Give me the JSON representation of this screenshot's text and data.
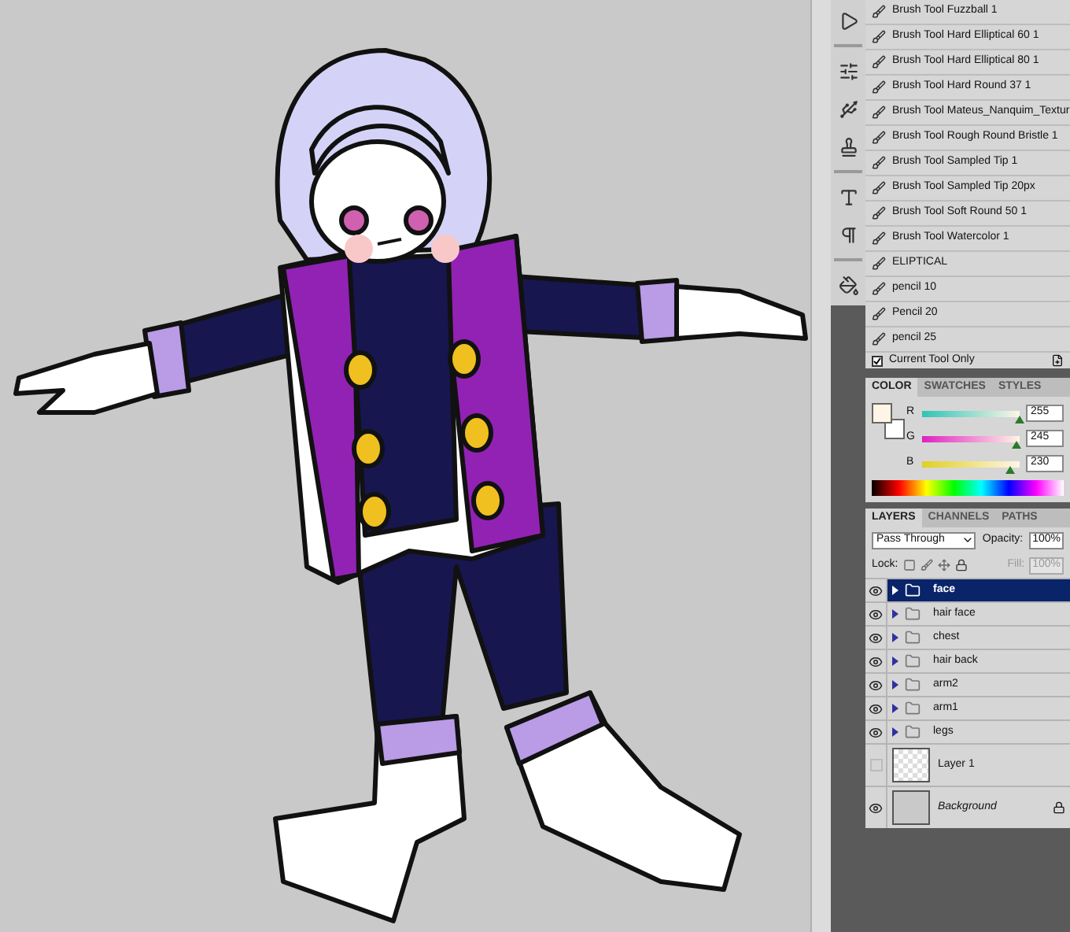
{
  "tool_presets": {
    "items": [
      {
        "label": "Brush Tool Fuzzball 1"
      },
      {
        "label": "Brush Tool Hard Elliptical 60 1"
      },
      {
        "label": "Brush Tool Hard Elliptical 80 1"
      },
      {
        "label": "Brush Tool Hard Round 37 1"
      },
      {
        "label": "Brush Tool Mateus_Nanquim_Textur"
      },
      {
        "label": "Brush Tool Rough Round Bristle 1"
      },
      {
        "label": "Brush Tool Sampled Tip 1"
      },
      {
        "label": "Brush Tool Sampled Tip 20px"
      },
      {
        "label": "Brush Tool Soft Round 50 1"
      },
      {
        "label": "Brush Tool Watercolor 1"
      },
      {
        "label": "ELIPTICAL"
      },
      {
        "label": "pencil 10"
      },
      {
        "label": "Pencil 20"
      },
      {
        "label": "pencil 25"
      }
    ],
    "current_tool_only": {
      "label": "Current Tool Only",
      "checked": true
    }
  },
  "color_panel": {
    "tabs": [
      {
        "label": "COLOR",
        "selected": true
      },
      {
        "label": "SWATCHES",
        "selected": false
      },
      {
        "label": "STYLES",
        "selected": false
      }
    ],
    "sliders": [
      {
        "channel": "R",
        "level": 1.0,
        "reading": "255"
      },
      {
        "channel": "G",
        "level": 0.96,
        "reading": "245"
      },
      {
        "channel": "B",
        "level": 0.9,
        "reading": "230"
      }
    ]
  },
  "layers_panel": {
    "tabs": [
      {
        "label": "LAYERS",
        "selected": true
      },
      {
        "label": "CHANNELS",
        "selected": false
      },
      {
        "label": "PATHS",
        "selected": false
      }
    ],
    "blend_mode": "Pass Through",
    "opacity_label": "Opacity:",
    "opacity": "100%",
    "lock_label": "Lock:",
    "fill_label": "Fill:",
    "fill": "100%",
    "fill_disabled": true,
    "layers": [
      {
        "name": "face",
        "kind": "group",
        "visible": true,
        "selected": true
      },
      {
        "name": "hair face",
        "kind": "group",
        "visible": true,
        "selected": false
      },
      {
        "name": "chest",
        "kind": "group",
        "visible": true,
        "selected": false
      },
      {
        "name": "hair back",
        "kind": "group",
        "visible": true,
        "selected": false
      },
      {
        "name": "arm2",
        "kind": "group",
        "visible": true,
        "selected": false
      },
      {
        "name": "arm1",
        "kind": "group",
        "visible": true,
        "selected": false
      },
      {
        "name": "legs",
        "kind": "group",
        "visible": true,
        "selected": false
      },
      {
        "name": "Layer 1",
        "kind": "transparent",
        "visible": false,
        "selected": false
      },
      {
        "name": "Background",
        "kind": "background",
        "visible": true,
        "selected": false
      }
    ]
  }
}
